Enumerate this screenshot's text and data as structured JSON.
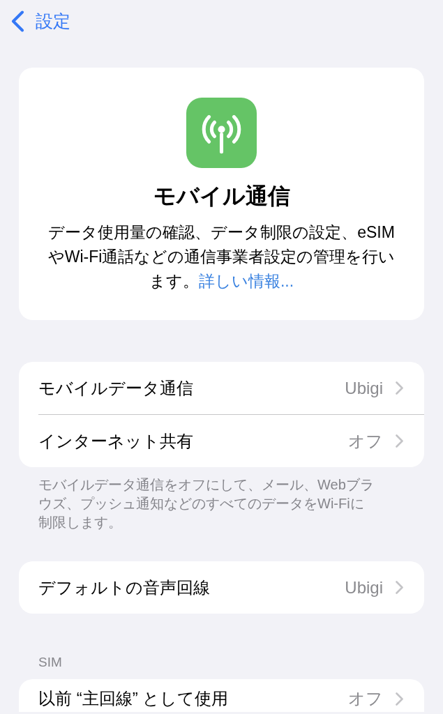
{
  "nav": {
    "back": "設定"
  },
  "hero": {
    "title": "モバイル通信",
    "description": "データ使用量の確認、データ制限の設定、eSIMやWi-Fi通話などの通信事業者設定の管理を行います。",
    "link": "詳しい情報..."
  },
  "sections": [
    {
      "rows": [
        {
          "label": "モバイルデータ通信",
          "value": "Ubigi"
        },
        {
          "label": "インターネット共有",
          "value": "オフ"
        }
      ],
      "footer": "モバイルデータ通信をオフにして、メール、Webブラウズ、プッシュ通知などのすべてのデータをWi-Fiに制限します。"
    },
    {
      "rows": [
        {
          "label": "デフォルトの音声回線",
          "value": "Ubigi"
        }
      ]
    },
    {
      "header": "SIM",
      "rows": [
        {
          "label": "以前 “主回線” として使用",
          "value": "オフ"
        }
      ]
    }
  ]
}
